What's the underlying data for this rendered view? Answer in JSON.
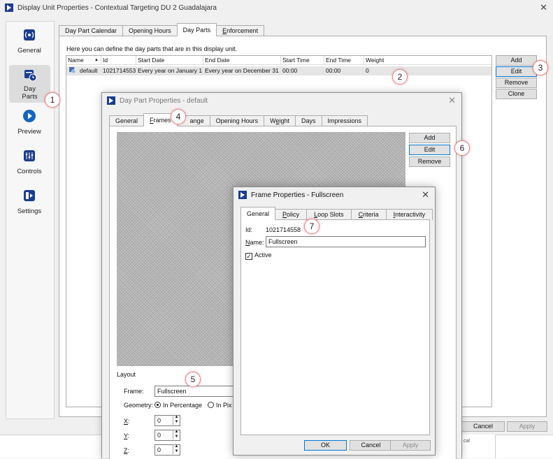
{
  "main_window": {
    "title": "Display Unit Properties - Contextual Targeting DU 2 Guadalajara",
    "close_glyph": "✕"
  },
  "sidebar": {
    "items": [
      {
        "label": "General",
        "icon": "broadcast-icon"
      },
      {
        "label_line1": "Day",
        "label_line2": "Parts",
        "icon": "calendar-clock-icon",
        "selected": true
      },
      {
        "label": "Preview",
        "icon": "play-icon"
      },
      {
        "label": "Controls",
        "icon": "sliders-icon"
      },
      {
        "label": "Settings",
        "icon": "settings-icon"
      }
    ]
  },
  "main_tabs": [
    "Day Part Calendar",
    "Opening Hours",
    "Day Parts",
    "Enforcement"
  ],
  "day_parts": {
    "description": "Here you can define the day parts that are in this display unit.",
    "columns": [
      "Name",
      "Id",
      "Start Date",
      "End Date",
      "Start Time",
      "End Time",
      "Weight"
    ],
    "sort_glyph": "▲",
    "rows": [
      {
        "name": "default",
        "id": "1021714553",
        "start_date": "Every year on January 1",
        "end_date": "Every year on December 31",
        "start_time": "00:00",
        "end_time": "00:00",
        "weight": "0"
      }
    ],
    "buttons": [
      "Add",
      "Edit",
      "Remove",
      "Clone"
    ]
  },
  "main_footer": {
    "cancel": "Cancel",
    "apply": "Apply",
    "cut_text": "cal"
  },
  "day_part_dialog": {
    "title": "Day Part Properties - default",
    "close_glyph": "✕",
    "tabs": [
      "General",
      "Frames",
      "Range",
      "Opening Hours",
      "Weight",
      "Days",
      "Impressions"
    ],
    "tab_partial": "ange",
    "buttons": [
      "Add",
      "Edit",
      "Remove"
    ],
    "layout": {
      "section_label": "Layout",
      "frame_label": "Frame:",
      "frame_value": "Fullscreen",
      "geometry_label": "Geometry:",
      "in_percentage": "In Percentage",
      "in_pixels_partial": "In Pix",
      "x_label": "X:",
      "y_label": "Y:",
      "z_label": "Z:",
      "x_value": "0",
      "y_value": "0",
      "z_value": "0"
    }
  },
  "frame_dialog": {
    "title": "Frame Properties - Fullscreen",
    "close_glyph": "✕",
    "tabs": [
      "General",
      "Policy",
      "Loop Slots",
      "Criteria",
      "Interactivity"
    ],
    "id_label": "Id:",
    "id_value": "1021714558",
    "name_label": "Name:",
    "name_value": "Fullscreen",
    "active_label": "Active",
    "active_checked": true,
    "check_glyph": "✓",
    "ok": "OK",
    "cancel": "Cancel",
    "apply": "Apply"
  },
  "callouts": [
    "1",
    "2",
    "3",
    "4",
    "5",
    "6",
    "7"
  ],
  "colors": {
    "accent": "#1a3d8f",
    "callout_border": "#e88a8a",
    "selected_row": "#e5e5e5",
    "play_icon": "#1565c0"
  }
}
